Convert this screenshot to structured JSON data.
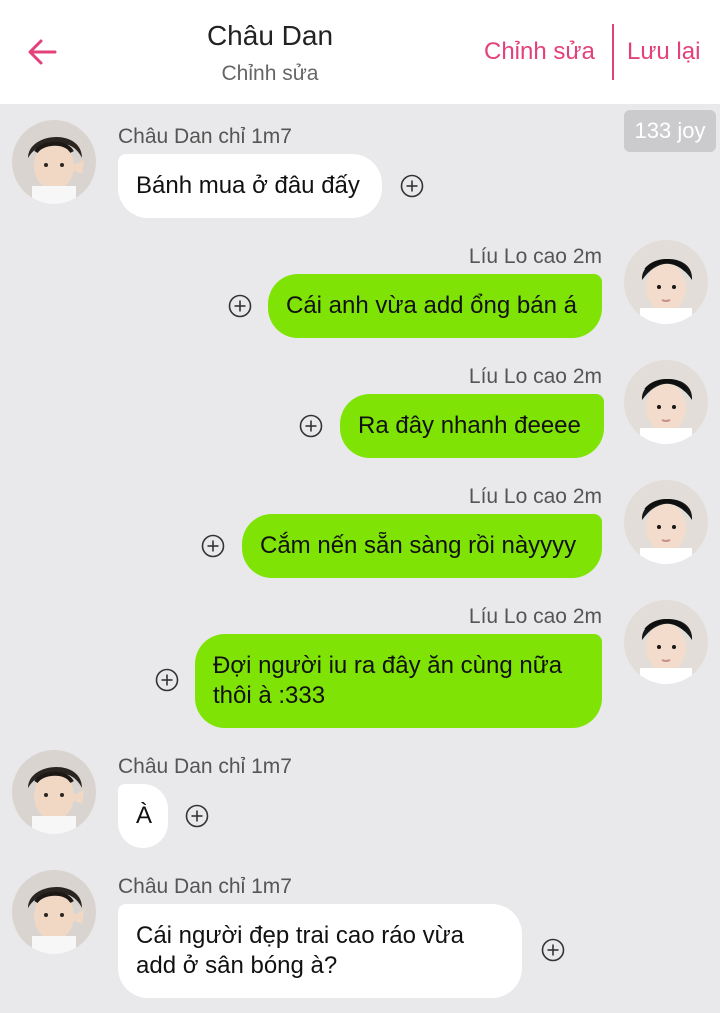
{
  "header": {
    "title": "Châu Dan",
    "subtitle": "Chỉnh sửa",
    "edit_label": "Chỉnh sửa",
    "save_label": "Lưu lại"
  },
  "coin_badge": "133 joy",
  "colors": {
    "accent": "#e3417b",
    "bubble_right": "#7fe405",
    "bubble_left": "#ffffff",
    "background": "#e9e9eb"
  },
  "messages": [
    {
      "side": "left",
      "sender": "Châu Dan chỉ 1m7",
      "text": "Bánh mua ở đâu đấy"
    },
    {
      "side": "right",
      "sender": "Líu Lo cao 2m",
      "text": "Cái anh vừa add ổng bán á"
    },
    {
      "side": "right",
      "sender": "Líu Lo cao 2m",
      "text": "Ra đây nhanh đeeee"
    },
    {
      "side": "right",
      "sender": "Líu Lo cao 2m",
      "text": "Cắm nến sẵn sàng rồi nàyyyy"
    },
    {
      "side": "right",
      "sender": "Líu Lo cao 2m",
      "text": "Đợi người iu ra đây ăn cùng nữa thôi à :333"
    },
    {
      "side": "left",
      "sender": "Châu Dan chỉ 1m7",
      "text": "À"
    },
    {
      "side": "left",
      "sender": "Châu Dan chỉ 1m7",
      "text": "Cái người đẹp trai cao ráo vừa add ở sân bóng à?"
    }
  ],
  "icons": {
    "back": "arrow-left-icon",
    "add": "plus-circle-icon",
    "avatar": "user-avatar"
  }
}
